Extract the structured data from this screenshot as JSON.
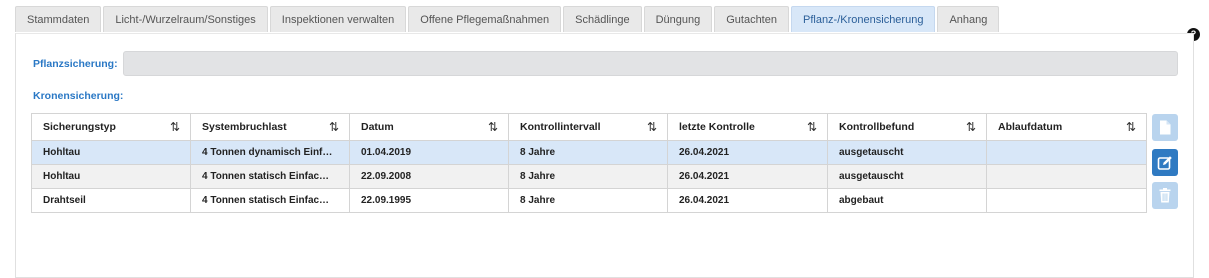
{
  "tabs": [
    {
      "label": "Stammdaten"
    },
    {
      "label": "Licht-/Wurzelraum/Sonstiges"
    },
    {
      "label": "Inspektionen verwalten"
    },
    {
      "label": "Offene Pflegemaßnahmen"
    },
    {
      "label": "Schädlinge"
    },
    {
      "label": "Düngung"
    },
    {
      "label": "Gutachten"
    },
    {
      "label": "Pflanz-/Kronensicherung",
      "active": true
    },
    {
      "label": "Anhang"
    }
  ],
  "help": {
    "icon": "question-circle-icon",
    "glyph": "?"
  },
  "pflanzsicherung": {
    "label": "Pflanzsicherung:",
    "value": ""
  },
  "kronensicherung": {
    "label": "Kronensicherung:",
    "columns": [
      "Sicherungstyp",
      "Systembruchlast",
      "Datum",
      "Kontrollintervall",
      "letzte Kontrolle",
      "Kontrollbefund",
      "Ablaufdatum"
    ],
    "sort_glyph": "⇅",
    "rows": [
      [
        "Hohltau",
        "4 Tonnen dynamisch Einf…",
        "01.04.2019",
        "8 Jahre",
        "26.04.2021",
        "ausgetauscht",
        ""
      ],
      [
        "Hohltau",
        "4 Tonnen statisch Einfac…",
        "22.09.2008",
        "8 Jahre",
        "26.04.2021",
        "ausgetauscht",
        ""
      ],
      [
        "Drahtseil",
        "4 Tonnen statisch Einfac…",
        "22.09.1995",
        "8 Jahre",
        "26.04.2021",
        "abgebaut",
        ""
      ]
    ],
    "selected_row": 0
  },
  "actions": {
    "new": "new-document-icon",
    "edit": "edit-icon",
    "delete": "trash-icon"
  },
  "colors": {
    "accent": "#2a78c5",
    "active_tab": "#d8e7f8",
    "selected_row": "#d8e7f8",
    "edit_button": "#2f7ac2",
    "disabled_button": "#b9d4ee"
  }
}
